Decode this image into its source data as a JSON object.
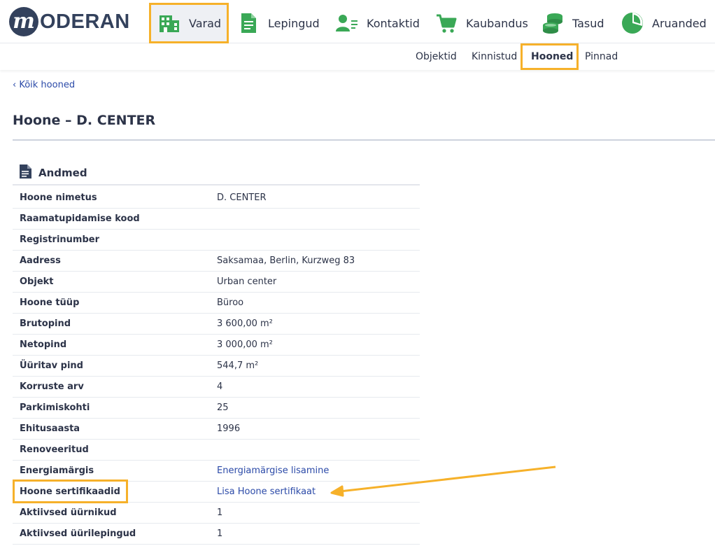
{
  "brand": {
    "logo_letter": "m",
    "logo_text": "ODERAN"
  },
  "nav": {
    "items": [
      {
        "label": "Varad",
        "icon": "buildings-icon"
      },
      {
        "label": "Lepingud",
        "icon": "document-icon"
      },
      {
        "label": "Kontaktid",
        "icon": "contact-card-icon"
      },
      {
        "label": "Kaubandus",
        "icon": "cart-icon"
      },
      {
        "label": "Tasud",
        "icon": "coins-icon"
      },
      {
        "label": "Aruanded",
        "icon": "pie-chart-icon"
      }
    ],
    "active": "Varad"
  },
  "subnav": {
    "items": [
      {
        "label": "Objektid"
      },
      {
        "label": "Kinnistud"
      },
      {
        "label": "Hooned"
      },
      {
        "label": "Pinnad"
      }
    ],
    "active": "Hooned"
  },
  "page": {
    "back_link": "‹ Kõik hooned",
    "title": "Hoone – D. CENTER"
  },
  "section": {
    "title": "Andmed",
    "icon": "document-icon",
    "rows": [
      {
        "label": "Hoone nimetus",
        "value": "D. CENTER"
      },
      {
        "label": "Raamatupidamise kood",
        "value": ""
      },
      {
        "label": "Registrinumber",
        "value": ""
      },
      {
        "label": "Aadress",
        "value": "Saksamaa, Berlin, Kurzweg 83"
      },
      {
        "label": "Objekt",
        "value": "Urban center"
      },
      {
        "label": "Hoone tüüp",
        "value": "Büroo"
      },
      {
        "label": "Brutopind",
        "value": "3 600,00 m²"
      },
      {
        "label": "Netopind",
        "value": "3 000,00 m²"
      },
      {
        "label": "Üüritav pind",
        "value": "544,7 m²"
      },
      {
        "label": "Korruste arv",
        "value": "4"
      },
      {
        "label": "Parkimiskohti",
        "value": "25"
      },
      {
        "label": "Ehitusaasta",
        "value": "1996"
      },
      {
        "label": "Renoveeritud",
        "value": ""
      },
      {
        "label": "Energiamärgis",
        "value": "Energiamärgise lisamine"
      },
      {
        "label": "Hoone sertifikaadid",
        "value": "Lisa Hoone sertifikaat"
      },
      {
        "label": "Aktiivsed üürnikud",
        "value": "1"
      },
      {
        "label": "Aktiivsed üürilepingud",
        "value": "1"
      }
    ]
  },
  "colors": {
    "accent_green": "#3aa856",
    "highlight": "#f6b12a",
    "link": "#2b4aa8",
    "text": "#2c3348",
    "brand_dark": "#33415c"
  }
}
